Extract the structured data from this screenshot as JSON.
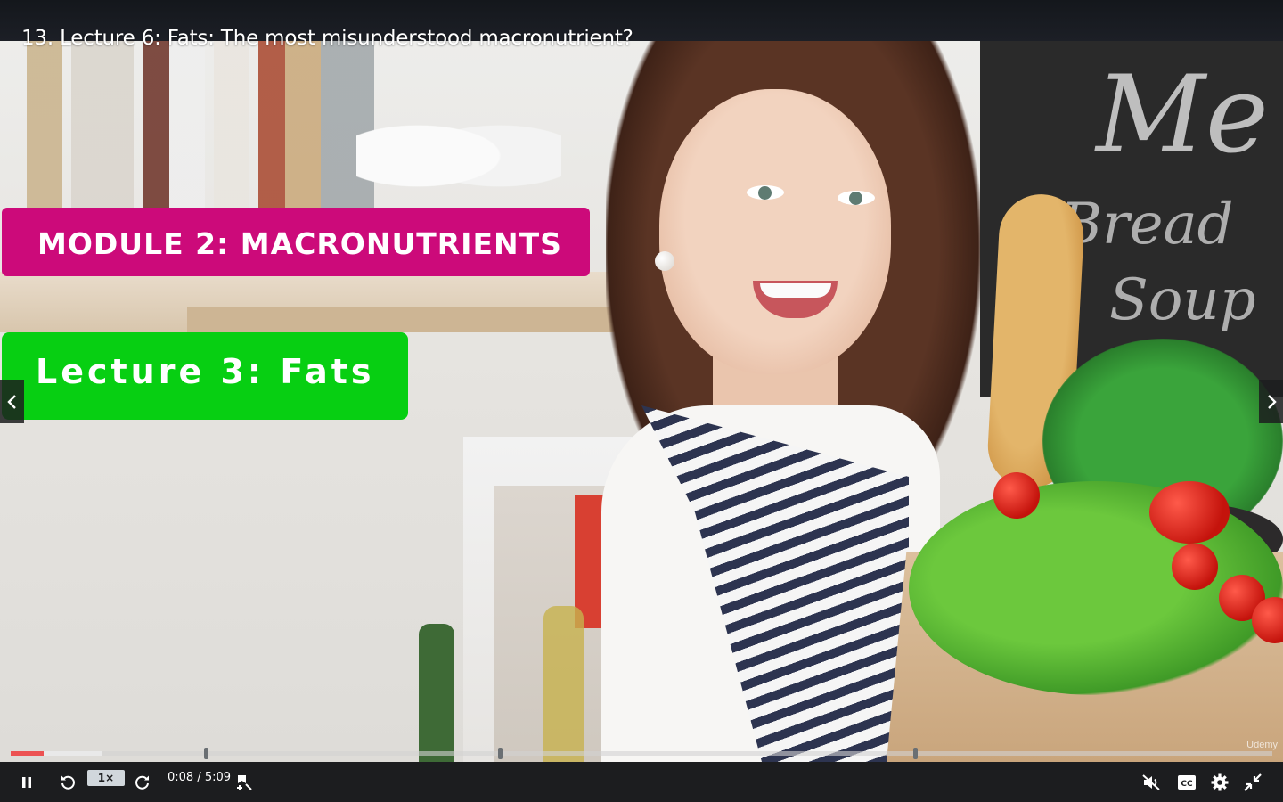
{
  "lecture": {
    "title": "13. Lecture 6: Fats: The most misunderstood macronutrient?"
  },
  "slide": {
    "module_label": "MODULE 2: MACRONUTRIENTS",
    "lecture_label": "Lecture 3: Fats",
    "module_color": "#cc0a7a",
    "lecture_color": "#07cf12",
    "chalkboard_lines": [
      "Me",
      "Bread",
      "Soup"
    ],
    "watermark": "Udemy"
  },
  "navigation": {
    "prev_icon": "chevron-left-icon",
    "next_icon": "chevron-right-icon"
  },
  "player": {
    "accent_color": "#ec5252",
    "progress_played_fraction": 0.026,
    "progress_buffered_fraction": 0.072,
    "chapter_markers_fraction": [
      0.155,
      0.388,
      0.717
    ],
    "speed": "1×",
    "current_time": "0:08",
    "duration": "5:09",
    "time_display": "0:08 / 5:09",
    "icons": {
      "play_pause": "pause-icon",
      "rewind": "rewind-5s-icon",
      "forward": "forward-5s-icon",
      "bookmark": "add-note-icon",
      "volume": "volume-muted-icon",
      "captions": "captions-icon",
      "settings": "gear-icon",
      "fullscreen": "exit-fullscreen-icon"
    }
  }
}
